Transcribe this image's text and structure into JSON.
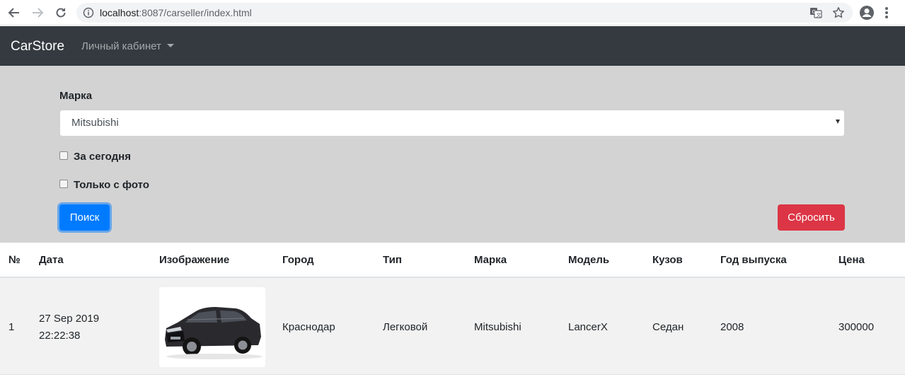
{
  "browser": {
    "url_host": "localhost",
    "url_rest": ":8087/carseller/index.html"
  },
  "navbar": {
    "brand": "CarStore",
    "dropdown_label": "Личный кабинет"
  },
  "filter": {
    "brand_label": "Марка",
    "brand_selected": "Mitsubishi",
    "today_label": "За сегодня",
    "today_checked": false,
    "photo_label": "Только с фото",
    "photo_checked": false,
    "search_button": "Поиск",
    "reset_button": "Сбросить"
  },
  "colors": {
    "navbar": "#343a40",
    "panel": "#d3d3d3",
    "primary": "#007bff",
    "danger": "#dc3545"
  },
  "table": {
    "headers": [
      "№",
      "Дата",
      "Изображение",
      "Город",
      "Тип",
      "Марка",
      "Модель",
      "Кузов",
      "Год выпуска",
      "Цена"
    ],
    "rows": [
      {
        "num": "1",
        "date": "27 Sep 2019",
        "time": "22:22:38",
        "image": "car-photo",
        "city": "Краснодар",
        "type": "Легковой",
        "brand": "Mitsubishi",
        "model": "LancerX",
        "body": "Седан",
        "year": "2008",
        "price": "300000"
      }
    ]
  }
}
